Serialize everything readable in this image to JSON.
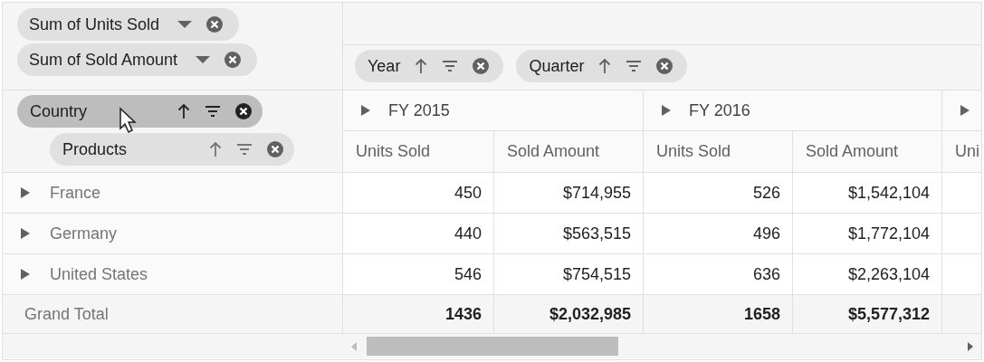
{
  "values_pills": [
    {
      "label": "Sum of Units Sold"
    },
    {
      "label": "Sum of Sold Amount"
    }
  ],
  "column_pills": [
    {
      "label": "Year"
    },
    {
      "label": "Quarter"
    }
  ],
  "row_pills": [
    {
      "label": "Country",
      "active": true
    },
    {
      "label": "Products",
      "active": false
    }
  ],
  "column_groups": [
    {
      "label": "FY 2015"
    },
    {
      "label": "FY 2016"
    },
    {
      "partial": true
    }
  ],
  "columns": [
    "Units Sold",
    "Sold Amount",
    "Units Sold",
    "Sold Amount",
    "Uni"
  ],
  "rows": [
    {
      "label": "France",
      "cells": [
        "450",
        "$714,955",
        "526",
        "$1,542,104"
      ]
    },
    {
      "label": "Germany",
      "cells": [
        "440",
        "$563,515",
        "496",
        "$1,772,104"
      ]
    },
    {
      "label": "United States",
      "cells": [
        "546",
        "$754,515",
        "636",
        "$2,263,104"
      ]
    }
  ],
  "grand_total": {
    "label": "Grand Total",
    "cells": [
      "1436",
      "$2,032,985",
      "1658",
      "$5,577,312"
    ]
  }
}
